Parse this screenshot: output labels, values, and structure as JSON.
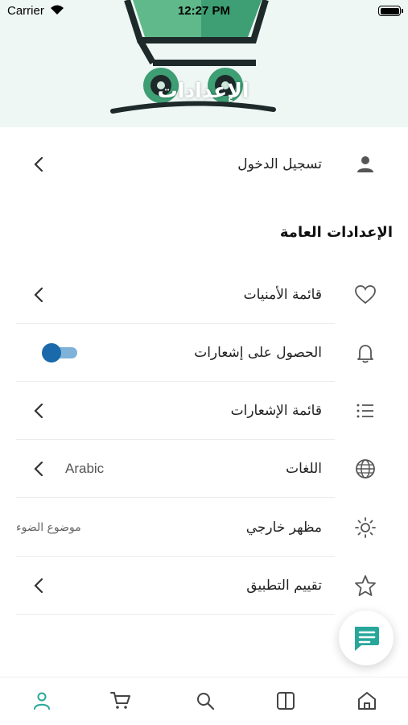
{
  "status_bar": {
    "carrier": "Carrier",
    "time": "12:27 PM"
  },
  "header": {
    "title": "الإعدادات"
  },
  "account": {
    "login_label": "تسجيل الدخول"
  },
  "general": {
    "section_title": "الإعدادات العامة",
    "items": [
      {
        "label": "قائمة الأمنيات",
        "icon": "heart-icon"
      },
      {
        "label": "الحصول على إشعارات",
        "icon": "bell-icon",
        "toggle_on": true
      },
      {
        "label": "قائمة الإشعارات",
        "icon": "list-icon"
      },
      {
        "label": "اللغات",
        "icon": "globe-icon",
        "value": "Arabic"
      },
      {
        "label": "مظهر خارجي",
        "icon": "sun-icon",
        "value": "موضوع الضوء"
      },
      {
        "label": "تقييم التطبيق",
        "icon": "star-icon"
      }
    ]
  },
  "tabbar": {
    "tabs": [
      {
        "icon": "home-icon"
      },
      {
        "icon": "book-icon"
      },
      {
        "icon": "search-icon"
      },
      {
        "icon": "cart-icon"
      },
      {
        "icon": "profile-icon",
        "active": true
      }
    ]
  },
  "colors": {
    "accent": "#27a79a",
    "toggle": "#1a6aab",
    "chevron": "#333333",
    "icon": "#555555"
  }
}
